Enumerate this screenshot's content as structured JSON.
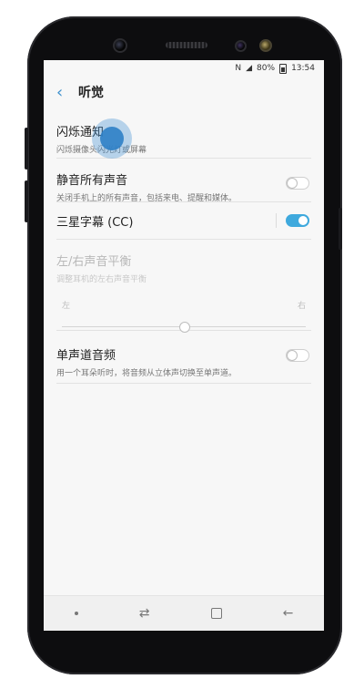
{
  "status": {
    "nfc": "N",
    "battery_percent": "80%",
    "time": "13:54"
  },
  "header": {
    "back_icon": "‹",
    "title": "听觉"
  },
  "settings": {
    "flash_notification": {
      "title": "闪烁通知",
      "subtitle": "闪烁摄像头闪光灯或屏幕"
    },
    "mute_all": {
      "title": "静音所有声音",
      "subtitle": "关闭手机上的所有声音，包括来电、提醒和媒体。",
      "enabled": false
    },
    "samsung_subtitles": {
      "title": "三星字幕 (CC)",
      "enabled": true
    },
    "balance": {
      "title": "左/右声音平衡",
      "subtitle": "调整耳机的左右声音平衡",
      "left_label": "左",
      "right_label": "右",
      "value": 0.5
    },
    "mono_audio": {
      "title": "单声道音频",
      "subtitle": "用一个耳朵听时，将音频从立体声切换至单声道。",
      "enabled": false
    }
  },
  "nav": {
    "back_icon": "←",
    "recents_icon": "⇄"
  },
  "colors": {
    "accent": "#3e91ce",
    "toggle_on": "#3fa9dd"
  }
}
